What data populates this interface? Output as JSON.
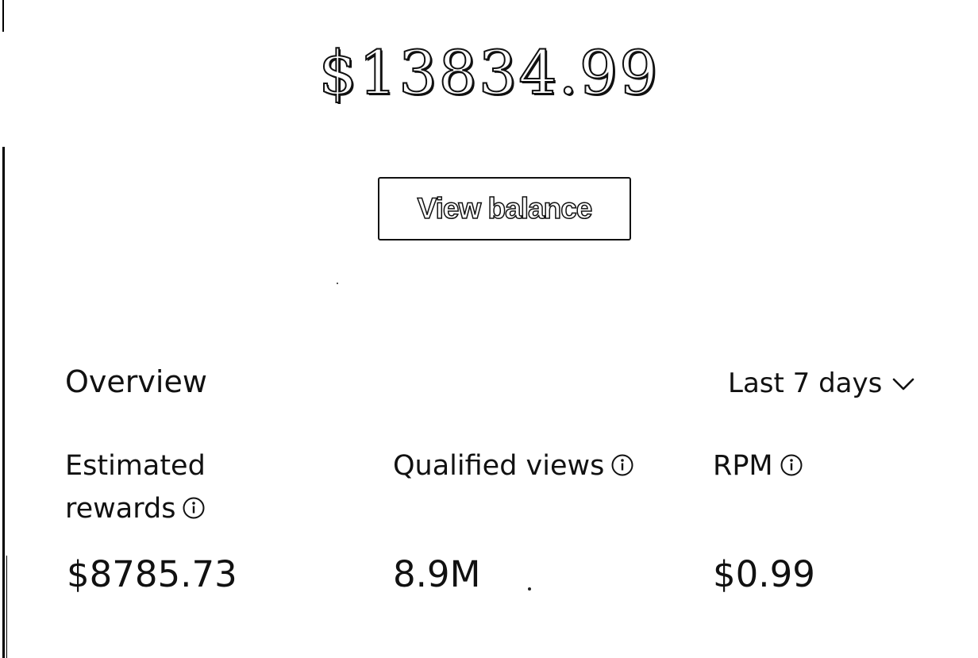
{
  "balance": {
    "amount": "$13834.99",
    "view_button_label": "View balance"
  },
  "overview": {
    "title": "Overview",
    "period_selected": "Last 7 days",
    "metrics": [
      {
        "label_line1": "Estimated",
        "label_line2": "rewards",
        "value": "$8785.73",
        "icon": "info-icon"
      },
      {
        "label": "Qualified views",
        "value": "8.9M",
        "icon": "info-icon"
      },
      {
        "label": "RPM",
        "value": "$0.99",
        "icon": "info-icon"
      }
    ]
  },
  "icons": {
    "period_dropdown": "chevron-down-icon",
    "metric_info": "info-icon"
  },
  "colors": {
    "text": "#111111",
    "background": "#ffffff"
  }
}
